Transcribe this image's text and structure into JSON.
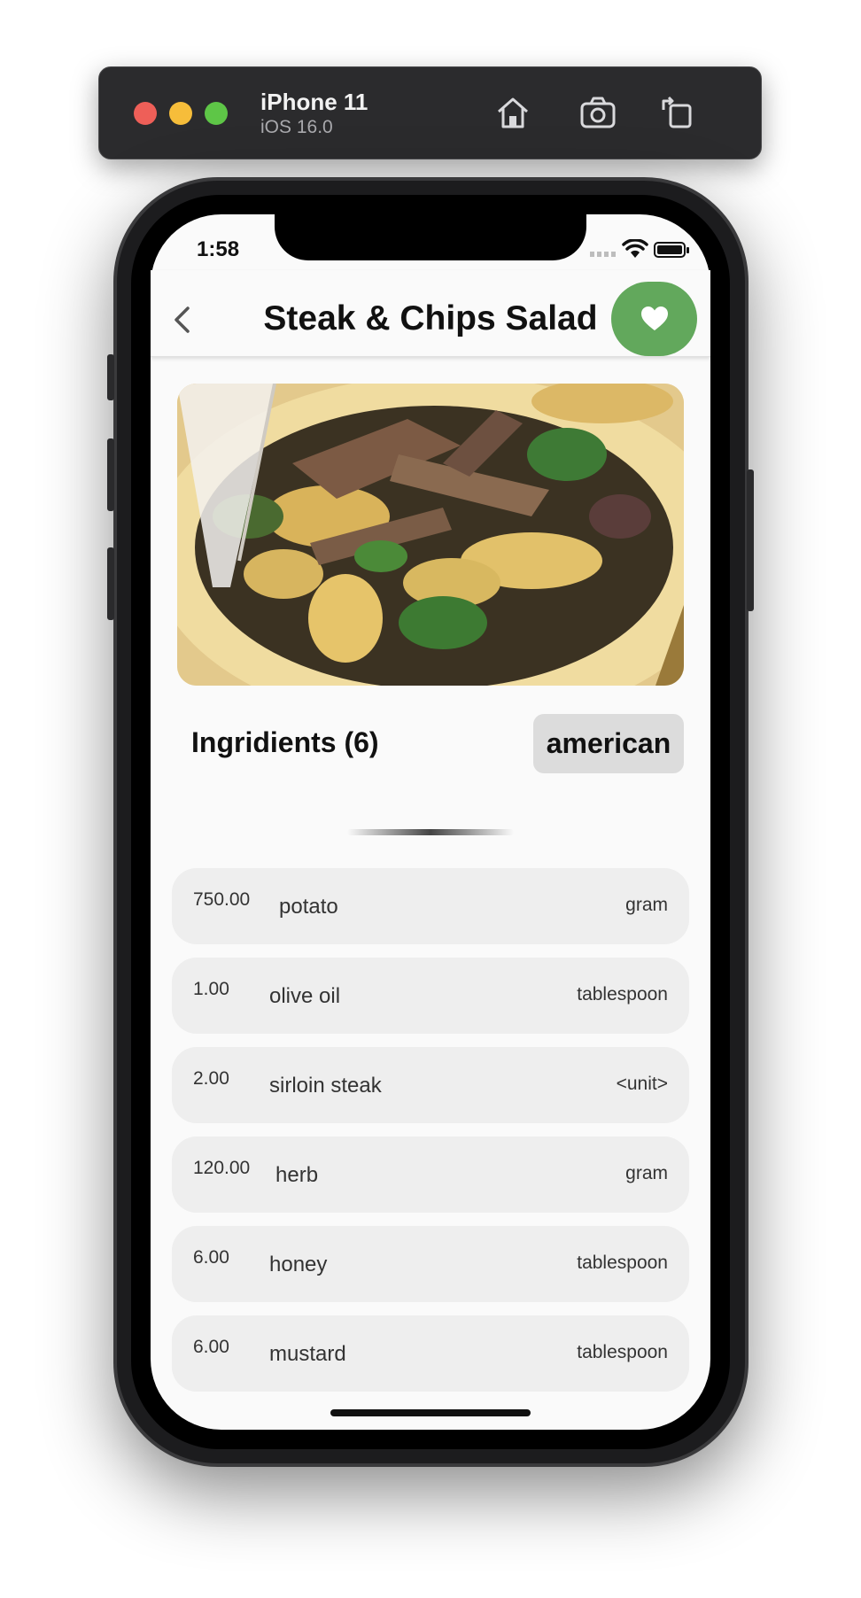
{
  "simulator": {
    "device_name": "iPhone 11",
    "os_version": "iOS 16.0",
    "icons": [
      "home-icon",
      "screenshot-icon",
      "rotate-icon"
    ]
  },
  "status_bar": {
    "time": "1:58",
    "icons": [
      "signal-icon",
      "wifi-icon",
      "battery-icon"
    ]
  },
  "app_bar": {
    "back_icon": "chevron-left-icon",
    "title": "Steak & Chips Salad",
    "favorite_icon": "heart-icon",
    "favorite_color": "#62a85c"
  },
  "recipe": {
    "photo_alt": "steak-and-chips-salad-photo",
    "ingredients_label": "Ingridients (6)",
    "cuisine_chip": "american"
  },
  "ingredients": [
    {
      "qty": "750.00",
      "name": "potato",
      "unit": "gram"
    },
    {
      "qty": "1.00",
      "name": "olive oil",
      "unit": "tablespoon"
    },
    {
      "qty": "2.00",
      "name": "sirloin steak",
      "unit": "<unit>"
    },
    {
      "qty": "120.00",
      "name": "herb",
      "unit": "gram"
    },
    {
      "qty": "6.00",
      "name": "honey",
      "unit": "tablespoon"
    },
    {
      "qty": "6.00",
      "name": "mustard",
      "unit": "tablespoon"
    }
  ]
}
